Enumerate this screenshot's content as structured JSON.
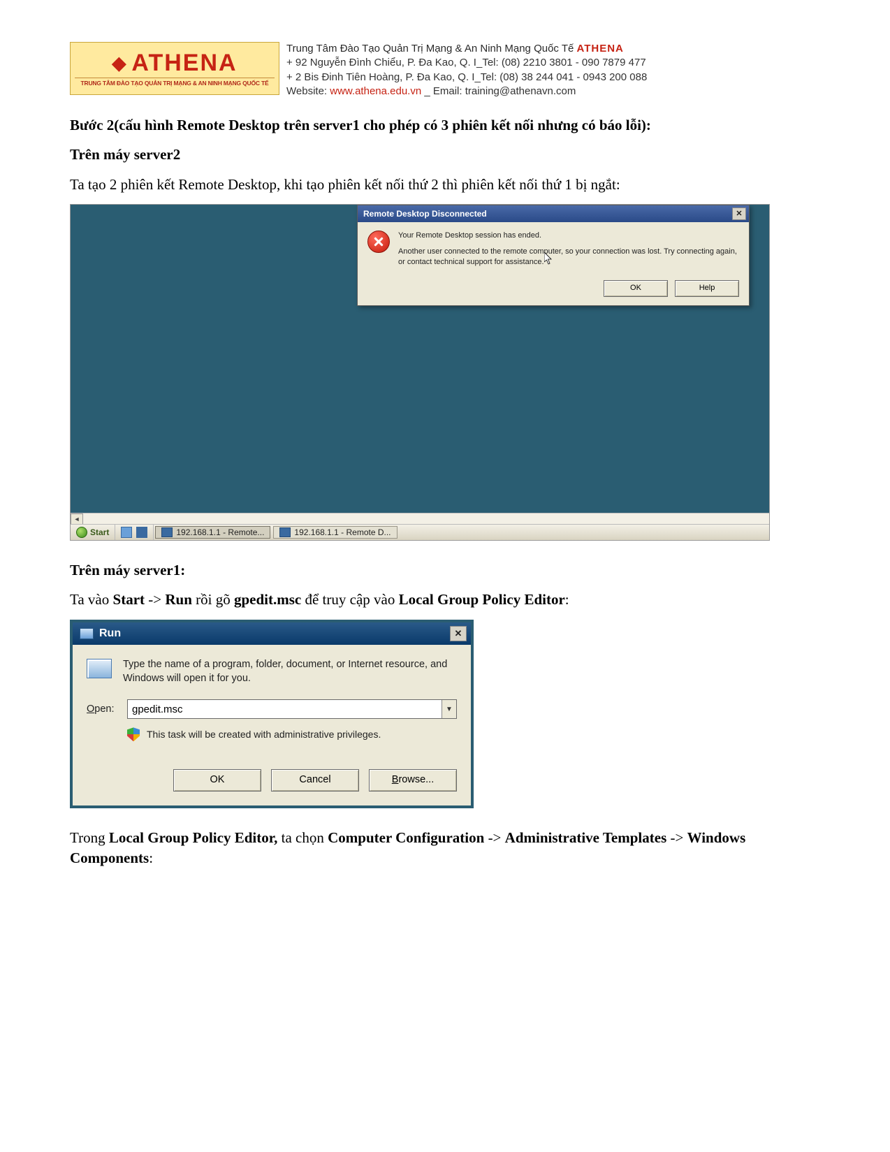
{
  "letterhead": {
    "logo_text": "ATHENA",
    "logo_sub": "TRUNG TÂM ĐÀO TẠO QUẢN TRỊ MẠNG & AN NINH MẠNG QUỐC TẾ",
    "line1_prefix": "Trung Tâm Đào Tạo Quản Trị Mạng & An Ninh Mạng Quốc Tế ",
    "line1_brand": "ATHENA",
    "line2": "+  92 Nguyễn Đình Chiểu, P. Đa Kao, Q. I_Tel: (08) 2210 3801 -  090 7879 477",
    "line3": "+  2 Bis Đinh Tiên Hoàng, P. Đa Kao, Q. I_Tel: (08) 38 244 041 - 0943 200 088",
    "line4_label": "Website: ",
    "line4_site": "www.athena.edu.vn",
    "line4_sep": "    _    ",
    "line4_email_label": "Email: ",
    "line4_email": "training@athenavn.com"
  },
  "body": {
    "step2_heading": "Bước 2(cấu hình Remote Desktop trên server1 cho phép có 3 phiên kết nối nhưng có báo lỗi):",
    "server2_heading": "Trên máy server2",
    "para1": "Ta tạo 2 phiên kết Remote Desktop, khi tạo phiên kết nối thứ 2 thì phiên kết nối thứ 1 bị ngắt:",
    "server1_heading": "Trên máy server1:",
    "para2_pre": "Ta vào ",
    "para2_start": "Start",
    "para2_arrow1": " -> ",
    "para2_run": "Run",
    "para2_mid": " rồi gõ ",
    "para2_cmd": "gpedit.msc",
    "para2_post1": " để truy cập vào ",
    "para2_target": "Local Group Policy Editor",
    "para2_end": ":",
    "para3_pre": "Trong ",
    "para3_a": "Local Group Policy Editor,",
    "para3_mid1": " ta chọn ",
    "para3_b": "Computer Configuration",
    "para3_arrow": " -> ",
    "para3_c": "Administrative Templates",
    "para3_d": "Windows Components",
    "para3_end": ":"
  },
  "sshot1": {
    "dlg_title": "Remote Desktop Disconnected",
    "msg1": "Your Remote Desktop session has ended.",
    "msg2": "Another user connected to the remote computer, so your connection was lost. Try connecting again, or contact technical support for assistance.",
    "ok": "OK",
    "help": "Help",
    "start": "Start",
    "task1": "192.168.1.1 - Remote...",
    "task2": "192.168.1.1 - Remote D..."
  },
  "sshot2": {
    "title": "Run",
    "desc": "Type the name of a program, folder, document, or Internet resource, and Windows will open it for you.",
    "open_label_u": "O",
    "open_label_rest": "pen:",
    "input_value": "gpedit.msc",
    "admin_note": "This task will be created with administrative privileges.",
    "ok": "OK",
    "cancel": "Cancel",
    "browse_u": "B",
    "browse_rest": "rowse..."
  }
}
